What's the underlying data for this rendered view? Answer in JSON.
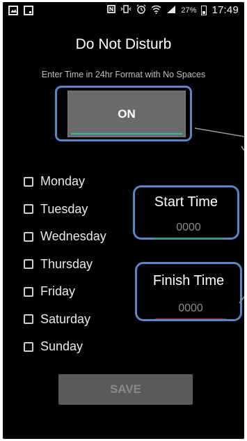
{
  "status_bar": {
    "battery_percent": "27%",
    "time": "17:49",
    "icons": [
      "image-icon",
      "save-icon",
      "nfc-icon",
      "vibrate-icon",
      "alarm-icon",
      "wifi-icon",
      "signal-icon",
      "battery-icon"
    ]
  },
  "screen": {
    "title": "Do Not Disturb",
    "instruction": "Enter Time in 24hr Format with No Spaces"
  },
  "toggle": {
    "label": "ON"
  },
  "days": [
    {
      "label": "Monday",
      "checked": false
    },
    {
      "label": "Tuesday",
      "checked": false
    },
    {
      "label": "Wednesday",
      "checked": false
    },
    {
      "label": "Thursday",
      "checked": false
    },
    {
      "label": "Friday",
      "checked": false
    },
    {
      "label": "Saturday",
      "checked": false
    },
    {
      "label": "Sunday",
      "checked": false
    }
  ],
  "start_time": {
    "label": "Start Time",
    "placeholder": "0000"
  },
  "finish_time": {
    "label": "Finish Time",
    "placeholder": "0000"
  },
  "save": {
    "label": "SAVE"
  },
  "colors": {
    "accent_highlight": "#5a86c6",
    "on_underline": "#34b7a7",
    "start_underline": "#28a06d",
    "finish_underline": "#8a1f2a"
  }
}
